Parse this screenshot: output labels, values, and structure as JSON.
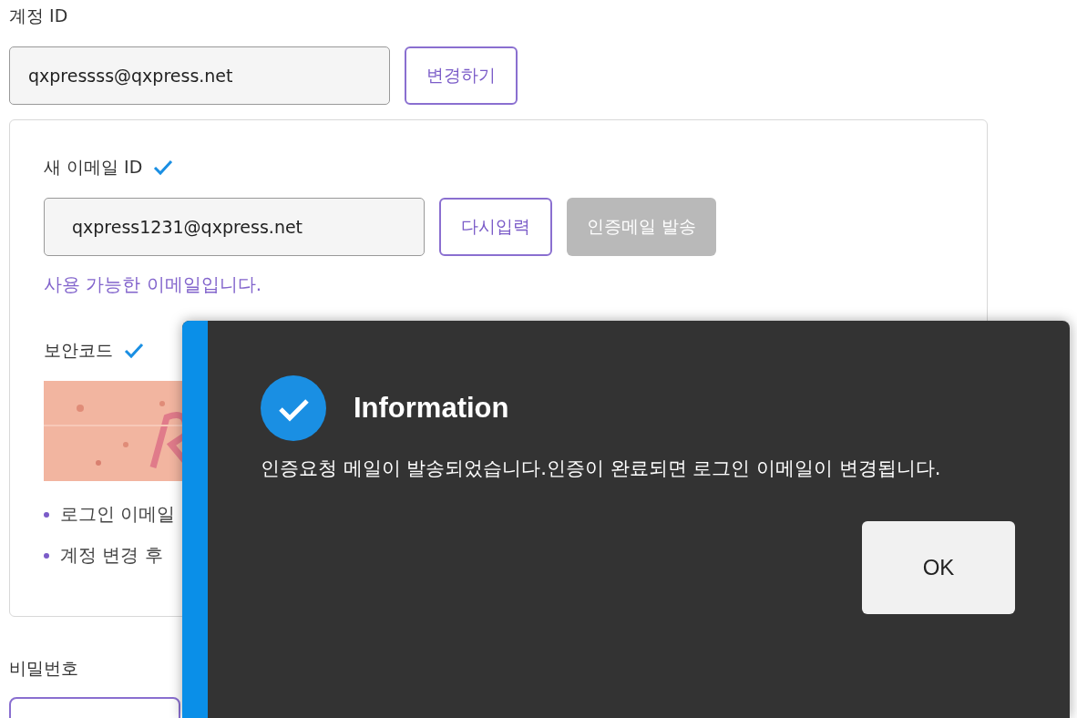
{
  "account": {
    "label": "계정 ID",
    "value": "qxpressss@qxpress.net",
    "button": {
      "label": "변경하기",
      "disabled": false
    }
  },
  "new_email": {
    "label": "새 이메일 ID",
    "verified": true,
    "value": "qxpress1231@qxpress.net",
    "buttons": [
      {
        "label": "다시입력",
        "disabled": false
      },
      {
        "label": "인증메일 발송",
        "disabled": true
      }
    ],
    "message": "사용 가능한 이메일입니다."
  },
  "security_code": {
    "label": "보안코드",
    "verified": true
  },
  "notes": [
    "로그인 이메일",
    "계정 변경 후"
  ],
  "password": {
    "label": "비밀번호"
  },
  "dialog": {
    "title": "Information",
    "message": "인증요청 메일이 발송되었습니다.인증이 완료되면 로그인 이메일이 변경됩니다.",
    "button": "OK"
  }
}
